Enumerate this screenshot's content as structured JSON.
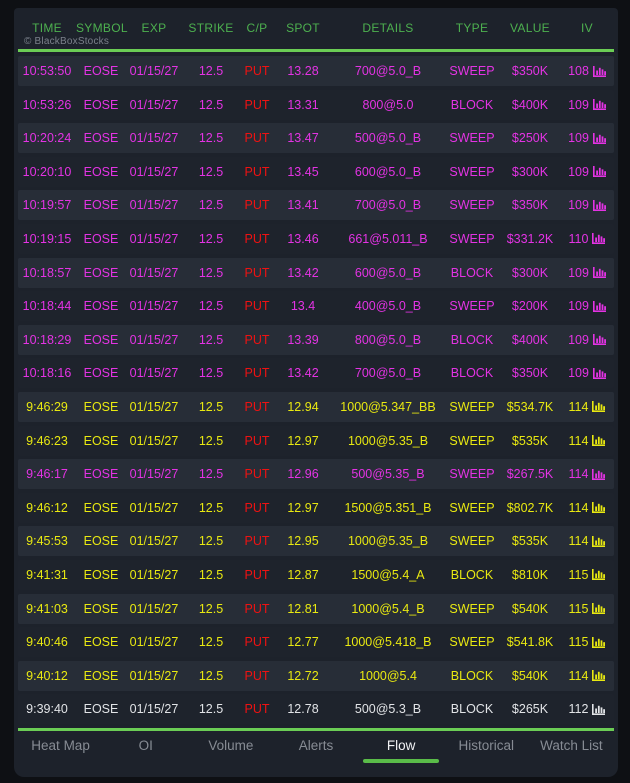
{
  "header": {
    "columns": [
      "TIME",
      "SYMBOL",
      "EXP",
      "STRIKE",
      "C/P",
      "SPOT",
      "DETAILS",
      "TYPE",
      "VALUE",
      "IV"
    ],
    "watermark": "© BlackBoxStocks"
  },
  "table": {
    "rows": [
      {
        "time": "10:53:50",
        "symbol": "EOSE",
        "exp": "01/15/27",
        "strike": "12.5",
        "cp": "PUT",
        "spot": "13.28",
        "details": "700@5.0_B",
        "type": "SWEEP",
        "value": "$350K",
        "iv": "108",
        "color": "magenta"
      },
      {
        "time": "10:53:26",
        "symbol": "EOSE",
        "exp": "01/15/27",
        "strike": "12.5",
        "cp": "PUT",
        "spot": "13.31",
        "details": "800@5.0",
        "type": "BLOCK",
        "value": "$400K",
        "iv": "109",
        "color": "magenta"
      },
      {
        "time": "10:20:24",
        "symbol": "EOSE",
        "exp": "01/15/27",
        "strike": "12.5",
        "cp": "PUT",
        "spot": "13.47",
        "details": "500@5.0_B",
        "type": "SWEEP",
        "value": "$250K",
        "iv": "109",
        "color": "magenta"
      },
      {
        "time": "10:20:10",
        "symbol": "EOSE",
        "exp": "01/15/27",
        "strike": "12.5",
        "cp": "PUT",
        "spot": "13.45",
        "details": "600@5.0_B",
        "type": "SWEEP",
        "value": "$300K",
        "iv": "109",
        "color": "magenta"
      },
      {
        "time": "10:19:57",
        "symbol": "EOSE",
        "exp": "01/15/27",
        "strike": "12.5",
        "cp": "PUT",
        "spot": "13.41",
        "details": "700@5.0_B",
        "type": "SWEEP",
        "value": "$350K",
        "iv": "109",
        "color": "magenta"
      },
      {
        "time": "10:19:15",
        "symbol": "EOSE",
        "exp": "01/15/27",
        "strike": "12.5",
        "cp": "PUT",
        "spot": "13.46",
        "details": "661@5.011_B",
        "type": "SWEEP",
        "value": "$331.2K",
        "iv": "110",
        "color": "magenta"
      },
      {
        "time": "10:18:57",
        "symbol": "EOSE",
        "exp": "01/15/27",
        "strike": "12.5",
        "cp": "PUT",
        "spot": "13.42",
        "details": "600@5.0_B",
        "type": "BLOCK",
        "value": "$300K",
        "iv": "109",
        "color": "magenta"
      },
      {
        "time": "10:18:44",
        "symbol": "EOSE",
        "exp": "01/15/27",
        "strike": "12.5",
        "cp": "PUT",
        "spot": "13.4",
        "details": "400@5.0_B",
        "type": "SWEEP",
        "value": "$200K",
        "iv": "109",
        "color": "magenta"
      },
      {
        "time": "10:18:29",
        "symbol": "EOSE",
        "exp": "01/15/27",
        "strike": "12.5",
        "cp": "PUT",
        "spot": "13.39",
        "details": "800@5.0_B",
        "type": "BLOCK",
        "value": "$400K",
        "iv": "109",
        "color": "magenta"
      },
      {
        "time": "10:18:16",
        "symbol": "EOSE",
        "exp": "01/15/27",
        "strike": "12.5",
        "cp": "PUT",
        "spot": "13.42",
        "details": "700@5.0_B",
        "type": "BLOCK",
        "value": "$350K",
        "iv": "109",
        "color": "magenta"
      },
      {
        "time": "9:46:29",
        "symbol": "EOSE",
        "exp": "01/15/27",
        "strike": "12.5",
        "cp": "PUT",
        "spot": "12.94",
        "details": "1000@5.347_BB",
        "type": "SWEEP",
        "value": "$534.7K",
        "iv": "114",
        "color": "yellow"
      },
      {
        "time": "9:46:23",
        "symbol": "EOSE",
        "exp": "01/15/27",
        "strike": "12.5",
        "cp": "PUT",
        "spot": "12.97",
        "details": "1000@5.35_B",
        "type": "SWEEP",
        "value": "$535K",
        "iv": "114",
        "color": "yellow"
      },
      {
        "time": "9:46:17",
        "symbol": "EOSE",
        "exp": "01/15/27",
        "strike": "12.5",
        "cp": "PUT",
        "spot": "12.96",
        "details": "500@5.35_B",
        "type": "SWEEP",
        "value": "$267.5K",
        "iv": "114",
        "color": "magenta"
      },
      {
        "time": "9:46:12",
        "symbol": "EOSE",
        "exp": "01/15/27",
        "strike": "12.5",
        "cp": "PUT",
        "spot": "12.97",
        "details": "1500@5.351_B",
        "type": "SWEEP",
        "value": "$802.7K",
        "iv": "114",
        "color": "yellow"
      },
      {
        "time": "9:45:53",
        "symbol": "EOSE",
        "exp": "01/15/27",
        "strike": "12.5",
        "cp": "PUT",
        "spot": "12.95",
        "details": "1000@5.35_B",
        "type": "SWEEP",
        "value": "$535K",
        "iv": "114",
        "color": "yellow"
      },
      {
        "time": "9:41:31",
        "symbol": "EOSE",
        "exp": "01/15/27",
        "strike": "12.5",
        "cp": "PUT",
        "spot": "12.87",
        "details": "1500@5.4_A",
        "type": "BLOCK",
        "value": "$810K",
        "iv": "115",
        "color": "yellow"
      },
      {
        "time": "9:41:03",
        "symbol": "EOSE",
        "exp": "01/15/27",
        "strike": "12.5",
        "cp": "PUT",
        "spot": "12.81",
        "details": "1000@5.4_B",
        "type": "SWEEP",
        "value": "$540K",
        "iv": "115",
        "color": "yellow"
      },
      {
        "time": "9:40:46",
        "symbol": "EOSE",
        "exp": "01/15/27",
        "strike": "12.5",
        "cp": "PUT",
        "spot": "12.77",
        "details": "1000@5.418_B",
        "type": "SWEEP",
        "value": "$541.8K",
        "iv": "115",
        "color": "yellow"
      },
      {
        "time": "9:40:12",
        "symbol": "EOSE",
        "exp": "01/15/27",
        "strike": "12.5",
        "cp": "PUT",
        "spot": "12.72",
        "details": "1000@5.4",
        "type": "BLOCK",
        "value": "$540K",
        "iv": "114",
        "color": "yellow"
      },
      {
        "time": "9:39:40",
        "symbol": "EOSE",
        "exp": "01/15/27",
        "strike": "12.5",
        "cp": "PUT",
        "spot": "12.78",
        "details": "500@5.3_B",
        "type": "BLOCK",
        "value": "$265K",
        "iv": "112",
        "color": "white"
      }
    ]
  },
  "footer": {
    "tabs": [
      {
        "label": "Heat Map",
        "active": false
      },
      {
        "label": "OI",
        "active": false
      },
      {
        "label": "Volume",
        "active": false
      },
      {
        "label": "Alerts",
        "active": false
      },
      {
        "label": "Flow",
        "active": true
      },
      {
        "label": "Historical",
        "active": false
      },
      {
        "label": "Watch List",
        "active": false
      }
    ]
  },
  "colors": {
    "accent_green": "#6bcd55",
    "header_green": "#4db04f",
    "magenta": "#e433e4",
    "yellow": "#e9e911",
    "put_red": "#ee1212",
    "white_row": "#e2e4e7"
  }
}
